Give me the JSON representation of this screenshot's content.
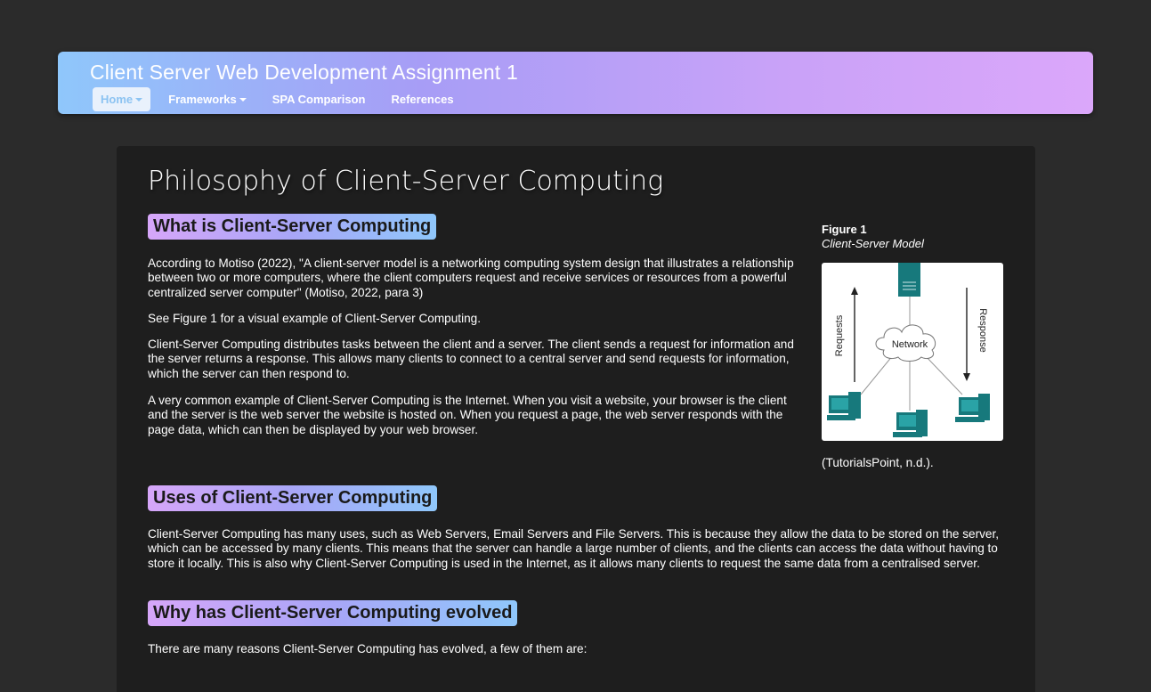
{
  "header": {
    "title": "Client Server Web Development Assignment 1",
    "nav": [
      {
        "label": "Home",
        "dropdown": true,
        "active": true
      },
      {
        "label": "Frameworks",
        "dropdown": true,
        "active": false
      },
      {
        "label": "SPA Comparison",
        "dropdown": false,
        "active": false
      },
      {
        "label": "References",
        "dropdown": false,
        "active": false
      }
    ]
  },
  "main": {
    "title": "Philosophy of Client-Server Computing",
    "sections": [
      {
        "heading": "What is Client-Server Computing",
        "paragraphs": [
          "According to Motiso (2022), \"A client-server model is a networking computing system design that illustrates a relationship between two or more computers, where the client computers request and receive services or resources from a powerful centralized server computer\" (Motiso, 2022, para 3)",
          "See Figure 1 for a visual example of Client-Server Computing.",
          "Client-Server Computing distributes tasks between the client and a server. The client sends a request for information and the server returns a response. This allows many clients to connect to a central server and send requests for information, which the server can then respond to.",
          "A very common example of Client-Server Computing is the Internet. When you visit a website, your browser is the client and the server is the web server the website is hosted on. When you request a page, the web server responds with the page data, which can then be displayed by your web browser."
        ]
      },
      {
        "heading": "Uses of Client-Server Computing",
        "paragraphs": [
          "Client-Server Computing has many uses, such as Web Servers, Email Servers and File Servers. This is because they allow the data to be stored on the server, which can be accessed by many clients. This means that the server can handle a large number of clients, and the clients can access the data without having to store it locally. This is also why Client-Server Computing is used in the Internet, as it allows many clients to request the same data from a centralised server."
        ]
      },
      {
        "heading": "Why has Client-Server Computing evolved",
        "paragraphs": [
          "There are many reasons Client-Server Computing has evolved, a few of them are:"
        ]
      }
    ],
    "figure": {
      "label": "Figure 1",
      "caption": "Client-Server Model",
      "diagram": {
        "left_arrow_label": "Requests",
        "right_arrow_label": "Response",
        "cloud_label": "Network",
        "device_color": "#17797c"
      },
      "citation": "(TutorialsPoint, n.d.)."
    }
  },
  "colors": {
    "background": "#2b2b2b",
    "panel": "#1e1e1e",
    "accent_blue": "#8fc7fb",
    "accent_purple": "#d6a6f9",
    "link": "#8fb5f7"
  }
}
